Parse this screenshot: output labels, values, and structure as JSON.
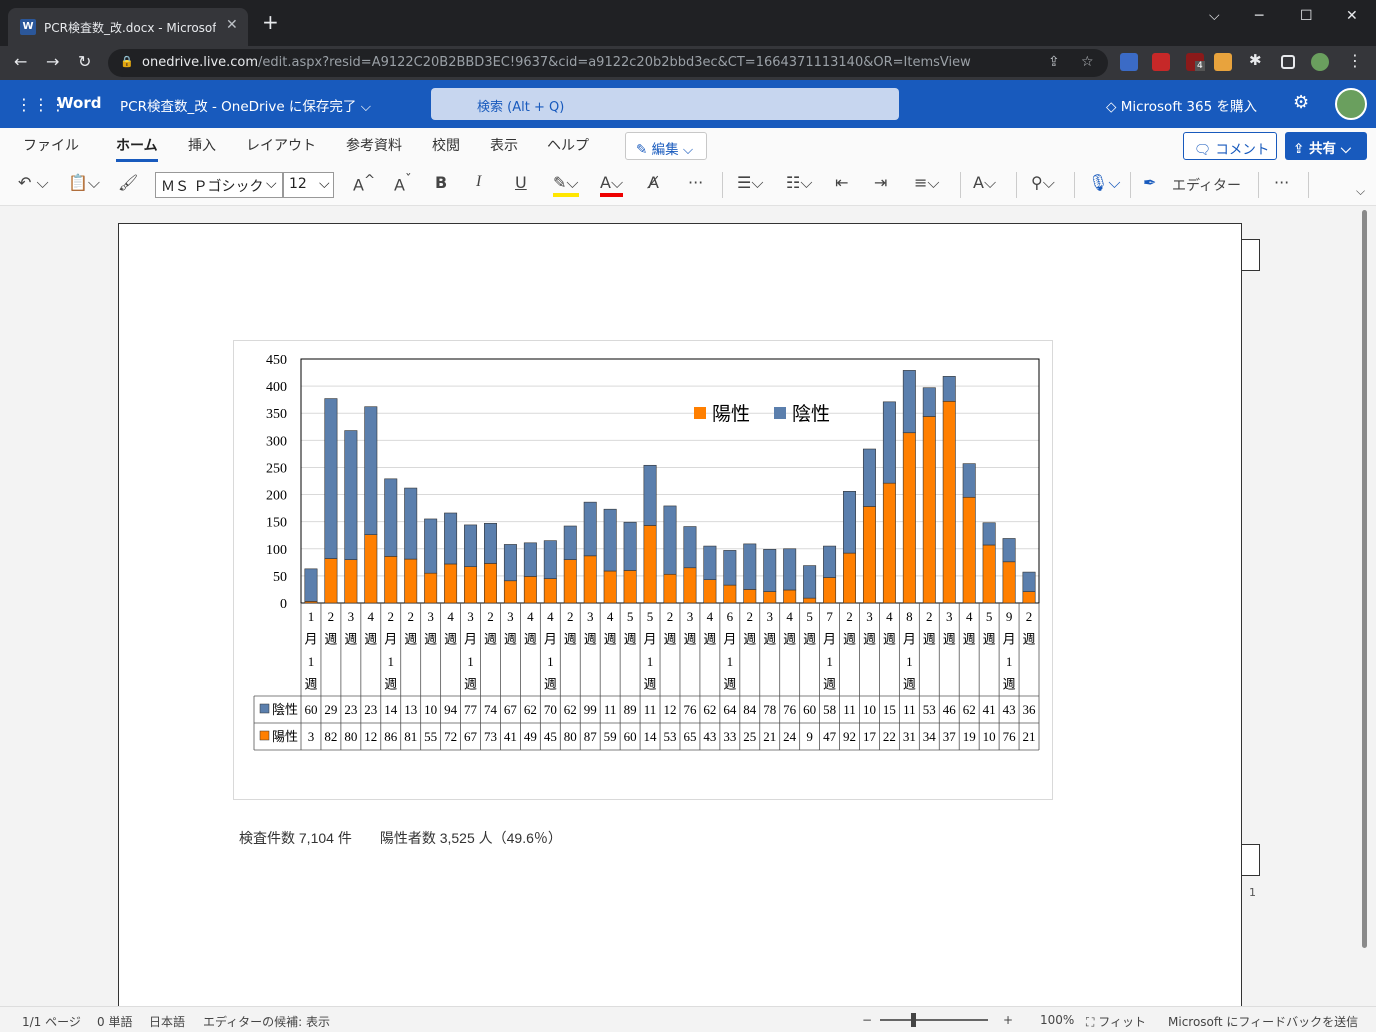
{
  "browser": {
    "tab_title": "PCR検査数_改.docx - Microsoft W",
    "tab_close": "✕",
    "new_tab": "+",
    "url_domain": "onedrive.live.com",
    "url_path": "/edit.aspx?resid=A9122C20B2BBD3EC!9637&cid=a9122c20b2bbd3ec&CT=1664371113140&OR=ItemsView",
    "extension_badge": "4"
  },
  "word": {
    "app_name": "Word",
    "doc_title": "PCR検査数_改 - OneDrive に保存完了 ⌵",
    "search_placeholder": "検索 (Alt + Q)",
    "buy_label": "Microsoft 365 を購入"
  },
  "menu": {
    "tabs": [
      "ファイル",
      "ホーム",
      "挿入",
      "レイアウト",
      "参考資料",
      "校閲",
      "表示",
      "ヘルプ"
    ],
    "edit_mode": "✎ 編集 ⌵",
    "comment": "🗨 コメント",
    "share": "⇪ 共有 ⌵"
  },
  "toolbar": {
    "font_name": "ＭＳ Ｐゴシック",
    "font_size": "12",
    "editor_label": "エディター"
  },
  "chart_data": {
    "type": "bar",
    "stacked": true,
    "categories": [
      "1月1週",
      "2週",
      "3週",
      "4週",
      "2月1週",
      "2週",
      "3週",
      "4週",
      "3月1週",
      "2週",
      "3週",
      "4週",
      "4月1週",
      "2週",
      "3週",
      "4週",
      "5週",
      "5月1週",
      "2週",
      "3週",
      "4週",
      "6月1週",
      "2週",
      "3週",
      "4週",
      "5週",
      "7月1週",
      "2週",
      "3週",
      "4週",
      "8月1週",
      "2週",
      "3週",
      "4週",
      "5週",
      "9月1週",
      "2週"
    ],
    "category_labels": [
      [
        "1",
        "月",
        "1",
        "週"
      ],
      [
        "2",
        "週"
      ],
      [
        "3",
        "週"
      ],
      [
        "4",
        "週"
      ],
      [
        "2",
        "月",
        "1",
        "週"
      ],
      [
        "2",
        "週"
      ],
      [
        "3",
        "週"
      ],
      [
        "4",
        "週"
      ],
      [
        "3",
        "月",
        "1",
        "週"
      ],
      [
        "2",
        "週"
      ],
      [
        "3",
        "週"
      ],
      [
        "4",
        "週"
      ],
      [
        "4",
        "月",
        "1",
        "週"
      ],
      [
        "2",
        "週"
      ],
      [
        "3",
        "週"
      ],
      [
        "4",
        "週"
      ],
      [
        "5",
        "週"
      ],
      [
        "5",
        "月",
        "1",
        "週"
      ],
      [
        "2",
        "週"
      ],
      [
        "3",
        "週"
      ],
      [
        "4",
        "週"
      ],
      [
        "6",
        "月",
        "1",
        "週"
      ],
      [
        "2",
        "週"
      ],
      [
        "3",
        "週"
      ],
      [
        "4",
        "週"
      ],
      [
        "5",
        "週"
      ],
      [
        "7",
        "月",
        "1",
        "週"
      ],
      [
        "2",
        "週"
      ],
      [
        "3",
        "週"
      ],
      [
        "4",
        "週"
      ],
      [
        "8",
        "月",
        "1",
        "週"
      ],
      [
        "2",
        "週"
      ],
      [
        "3",
        "週"
      ],
      [
        "4",
        "週"
      ],
      [
        "5",
        "週"
      ],
      [
        "9",
        "月",
        "1",
        "週"
      ],
      [
        "2",
        "週"
      ]
    ],
    "series": [
      {
        "name": "陽性",
        "color": "#ff7f00",
        "values": [
          3,
          82,
          80,
          126,
          86,
          81,
          55,
          72,
          67,
          73,
          41,
          49,
          45,
          80,
          87,
          59,
          60,
          143,
          53,
          65,
          43,
          33,
          25,
          21,
          24,
          9,
          47,
          92,
          178,
          221,
          314,
          344,
          372,
          195,
          107,
          76,
          21
        ]
      },
      {
        "name": "陰性",
        "color": "#5b7fad",
        "values": [
          60,
          295,
          238,
          236,
          143,
          131,
          100,
          94,
          77,
          74,
          67,
          62,
          70,
          62,
          99,
          114,
          89,
          111,
          126,
          76,
          62,
          64,
          84,
          78,
          76,
          60,
          58,
          114,
          106,
          150,
          115,
          53,
          46,
          62,
          41,
          43,
          36
        ]
      }
    ],
    "table_labels": {
      "陰性": [
        "60",
        "29",
        "23",
        "23",
        "14",
        "13",
        "10",
        "94",
        "77",
        "74",
        "67",
        "62",
        "70",
        "62",
        "99",
        "11",
        "89",
        "11",
        "12",
        "76",
        "62",
        "64",
        "84",
        "78",
        "76",
        "60",
        "58",
        "11",
        "10",
        "15",
        "11",
        "53",
        "46",
        "62",
        "41",
        "43",
        "36"
      ],
      "陽性": [
        "3",
        "82",
        "80",
        "12",
        "86",
        "81",
        "55",
        "72",
        "67",
        "73",
        "41",
        "49",
        "45",
        "80",
        "87",
        "59",
        "60",
        "14",
        "53",
        "65",
        "43",
        "33",
        "25",
        "21",
        "24",
        "9",
        "47",
        "92",
        "17",
        "22",
        "31",
        "34",
        "37",
        "19",
        "10",
        "76",
        "21"
      ]
    },
    "yticks": [
      "0",
      "50",
      "100",
      "150",
      "200",
      "250",
      "300",
      "350",
      "400",
      "450"
    ],
    "ylim": [
      0,
      450
    ],
    "legend": [
      "陽性",
      "陰性"
    ],
    "legend_position": "top-right",
    "grid": true
  },
  "document": {
    "summary": "検査件数 7,104 件　　陽性者数 3,525 人（49.6％）",
    "side_page_number": "1"
  },
  "status": {
    "page": "1/1 ページ",
    "words": "0 単語",
    "language": "日本語",
    "editor": "エディターの候補: 表示",
    "zoom": "100%",
    "fit": "フィット",
    "feedback": "Microsoft にフィードバックを送信"
  }
}
